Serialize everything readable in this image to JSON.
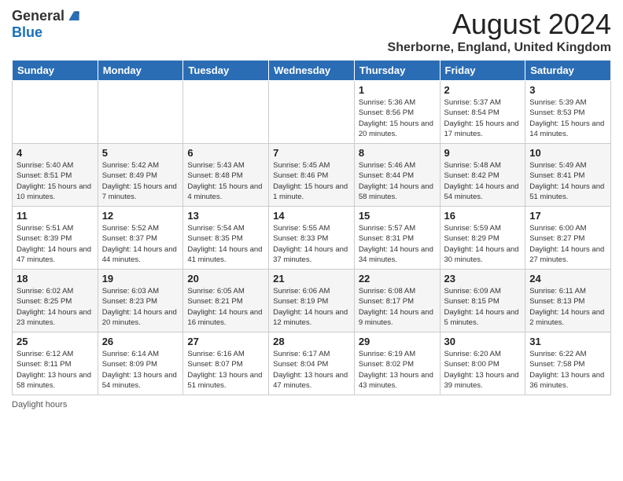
{
  "header": {
    "logo_general": "General",
    "logo_blue": "Blue",
    "month_year": "August 2024",
    "location": "Sherborne, England, United Kingdom"
  },
  "footer": {
    "daylight_hours": "Daylight hours"
  },
  "weekdays": [
    "Sunday",
    "Monday",
    "Tuesday",
    "Wednesday",
    "Thursday",
    "Friday",
    "Saturday"
  ],
  "weeks": [
    [
      {
        "day": "",
        "sunrise": "",
        "sunset": "",
        "daylight": ""
      },
      {
        "day": "",
        "sunrise": "",
        "sunset": "",
        "daylight": ""
      },
      {
        "day": "",
        "sunrise": "",
        "sunset": "",
        "daylight": ""
      },
      {
        "day": "",
        "sunrise": "",
        "sunset": "",
        "daylight": ""
      },
      {
        "day": "1",
        "sunrise": "Sunrise: 5:36 AM",
        "sunset": "Sunset: 8:56 PM",
        "daylight": "Daylight: 15 hours and 20 minutes."
      },
      {
        "day": "2",
        "sunrise": "Sunrise: 5:37 AM",
        "sunset": "Sunset: 8:54 PM",
        "daylight": "Daylight: 15 hours and 17 minutes."
      },
      {
        "day": "3",
        "sunrise": "Sunrise: 5:39 AM",
        "sunset": "Sunset: 8:53 PM",
        "daylight": "Daylight: 15 hours and 14 minutes."
      }
    ],
    [
      {
        "day": "4",
        "sunrise": "Sunrise: 5:40 AM",
        "sunset": "Sunset: 8:51 PM",
        "daylight": "Daylight: 15 hours and 10 minutes."
      },
      {
        "day": "5",
        "sunrise": "Sunrise: 5:42 AM",
        "sunset": "Sunset: 8:49 PM",
        "daylight": "Daylight: 15 hours and 7 minutes."
      },
      {
        "day": "6",
        "sunrise": "Sunrise: 5:43 AM",
        "sunset": "Sunset: 8:48 PM",
        "daylight": "Daylight: 15 hours and 4 minutes."
      },
      {
        "day": "7",
        "sunrise": "Sunrise: 5:45 AM",
        "sunset": "Sunset: 8:46 PM",
        "daylight": "Daylight: 15 hours and 1 minute."
      },
      {
        "day": "8",
        "sunrise": "Sunrise: 5:46 AM",
        "sunset": "Sunset: 8:44 PM",
        "daylight": "Daylight: 14 hours and 58 minutes."
      },
      {
        "day": "9",
        "sunrise": "Sunrise: 5:48 AM",
        "sunset": "Sunset: 8:42 PM",
        "daylight": "Daylight: 14 hours and 54 minutes."
      },
      {
        "day": "10",
        "sunrise": "Sunrise: 5:49 AM",
        "sunset": "Sunset: 8:41 PM",
        "daylight": "Daylight: 14 hours and 51 minutes."
      }
    ],
    [
      {
        "day": "11",
        "sunrise": "Sunrise: 5:51 AM",
        "sunset": "Sunset: 8:39 PM",
        "daylight": "Daylight: 14 hours and 47 minutes."
      },
      {
        "day": "12",
        "sunrise": "Sunrise: 5:52 AM",
        "sunset": "Sunset: 8:37 PM",
        "daylight": "Daylight: 14 hours and 44 minutes."
      },
      {
        "day": "13",
        "sunrise": "Sunrise: 5:54 AM",
        "sunset": "Sunset: 8:35 PM",
        "daylight": "Daylight: 14 hours and 41 minutes."
      },
      {
        "day": "14",
        "sunrise": "Sunrise: 5:55 AM",
        "sunset": "Sunset: 8:33 PM",
        "daylight": "Daylight: 14 hours and 37 minutes."
      },
      {
        "day": "15",
        "sunrise": "Sunrise: 5:57 AM",
        "sunset": "Sunset: 8:31 PM",
        "daylight": "Daylight: 14 hours and 34 minutes."
      },
      {
        "day": "16",
        "sunrise": "Sunrise: 5:59 AM",
        "sunset": "Sunset: 8:29 PM",
        "daylight": "Daylight: 14 hours and 30 minutes."
      },
      {
        "day": "17",
        "sunrise": "Sunrise: 6:00 AM",
        "sunset": "Sunset: 8:27 PM",
        "daylight": "Daylight: 14 hours and 27 minutes."
      }
    ],
    [
      {
        "day": "18",
        "sunrise": "Sunrise: 6:02 AM",
        "sunset": "Sunset: 8:25 PM",
        "daylight": "Daylight: 14 hours and 23 minutes."
      },
      {
        "day": "19",
        "sunrise": "Sunrise: 6:03 AM",
        "sunset": "Sunset: 8:23 PM",
        "daylight": "Daylight: 14 hours and 20 minutes."
      },
      {
        "day": "20",
        "sunrise": "Sunrise: 6:05 AM",
        "sunset": "Sunset: 8:21 PM",
        "daylight": "Daylight: 14 hours and 16 minutes."
      },
      {
        "day": "21",
        "sunrise": "Sunrise: 6:06 AM",
        "sunset": "Sunset: 8:19 PM",
        "daylight": "Daylight: 14 hours and 12 minutes."
      },
      {
        "day": "22",
        "sunrise": "Sunrise: 6:08 AM",
        "sunset": "Sunset: 8:17 PM",
        "daylight": "Daylight: 14 hours and 9 minutes."
      },
      {
        "day": "23",
        "sunrise": "Sunrise: 6:09 AM",
        "sunset": "Sunset: 8:15 PM",
        "daylight": "Daylight: 14 hours and 5 minutes."
      },
      {
        "day": "24",
        "sunrise": "Sunrise: 6:11 AM",
        "sunset": "Sunset: 8:13 PM",
        "daylight": "Daylight: 14 hours and 2 minutes."
      }
    ],
    [
      {
        "day": "25",
        "sunrise": "Sunrise: 6:12 AM",
        "sunset": "Sunset: 8:11 PM",
        "daylight": "Daylight: 13 hours and 58 minutes."
      },
      {
        "day": "26",
        "sunrise": "Sunrise: 6:14 AM",
        "sunset": "Sunset: 8:09 PM",
        "daylight": "Daylight: 13 hours and 54 minutes."
      },
      {
        "day": "27",
        "sunrise": "Sunrise: 6:16 AM",
        "sunset": "Sunset: 8:07 PM",
        "daylight": "Daylight: 13 hours and 51 minutes."
      },
      {
        "day": "28",
        "sunrise": "Sunrise: 6:17 AM",
        "sunset": "Sunset: 8:04 PM",
        "daylight": "Daylight: 13 hours and 47 minutes."
      },
      {
        "day": "29",
        "sunrise": "Sunrise: 6:19 AM",
        "sunset": "Sunset: 8:02 PM",
        "daylight": "Daylight: 13 hours and 43 minutes."
      },
      {
        "day": "30",
        "sunrise": "Sunrise: 6:20 AM",
        "sunset": "Sunset: 8:00 PM",
        "daylight": "Daylight: 13 hours and 39 minutes."
      },
      {
        "day": "31",
        "sunrise": "Sunrise: 6:22 AM",
        "sunset": "Sunset: 7:58 PM",
        "daylight": "Daylight: 13 hours and 36 minutes."
      }
    ]
  ]
}
